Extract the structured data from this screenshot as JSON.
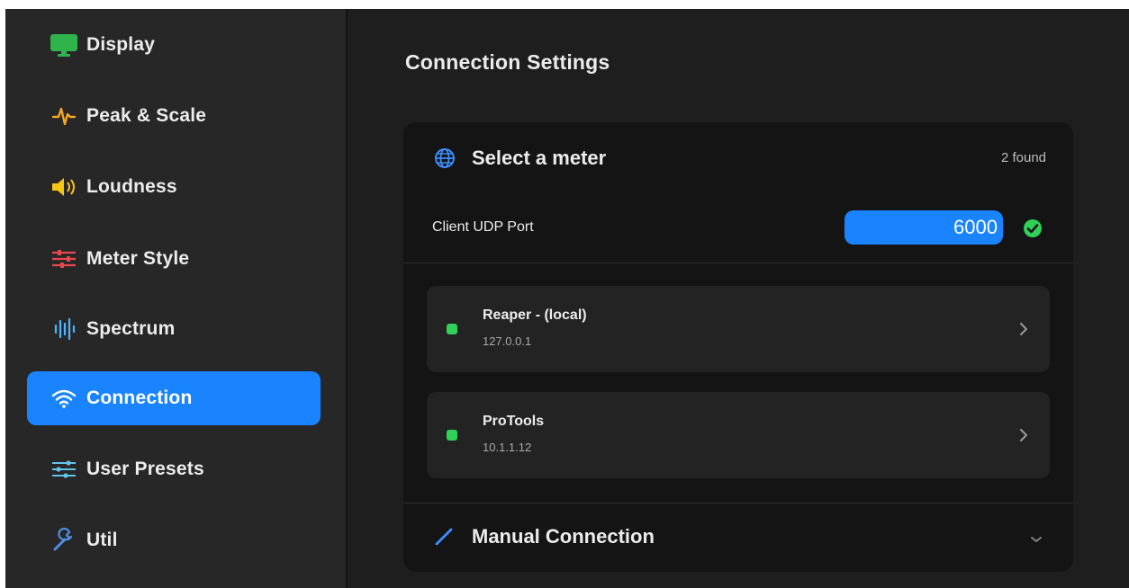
{
  "sidebar": {
    "items": [
      {
        "label": "Display",
        "icon": "display-icon",
        "active": false
      },
      {
        "label": "Peak & Scale",
        "icon": "waveform-icon",
        "active": false
      },
      {
        "label": "Loudness",
        "icon": "speaker-icon",
        "active": false
      },
      {
        "label": "Meter Style",
        "icon": "sliders-icon",
        "active": false
      },
      {
        "label": "Spectrum",
        "icon": "spectrum-icon",
        "active": false
      },
      {
        "label": "Connection",
        "icon": "wifi-icon",
        "active": true
      },
      {
        "label": "User Presets",
        "icon": "presets-icon",
        "active": false
      },
      {
        "label": "Util",
        "icon": "wrench-icon",
        "active": false
      }
    ]
  },
  "main": {
    "title": "Connection Settings",
    "select_meter": {
      "title": "Select a meter",
      "icon": "network-icon",
      "found_count": "2 found"
    },
    "port": {
      "label": "Client UDP Port",
      "value": "6000",
      "status": "valid"
    },
    "meters": [
      {
        "name": "Reaper - (local)",
        "ip": "127.0.0.1",
        "status": "online"
      },
      {
        "name": "ProTools",
        "ip": "10.1.1.12",
        "status": "online"
      }
    ],
    "manual": {
      "title": "Manual Connection",
      "icon": "pencil-icon"
    }
  },
  "colors": {
    "accent": "#1a84ff",
    "online": "#2fd158",
    "background": "#1e1e1e",
    "sidebar": "#272727",
    "card": "#141414"
  }
}
